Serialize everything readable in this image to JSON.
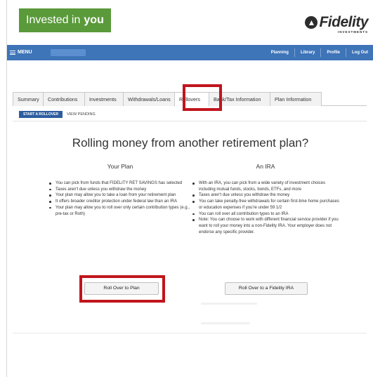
{
  "brand": {
    "invested_text": "Invested in",
    "invested_you": "you",
    "logo_word": "Fidelity",
    "logo_sub": "INVESTMENTS",
    "brand_green": "#5a9a3a"
  },
  "navbar": {
    "menu_label": "MENU",
    "links": [
      "Planning",
      "Library",
      "Profile",
      "Log Out"
    ],
    "color": "#3e74b8"
  },
  "tabs": {
    "items": [
      {
        "label": "Summary"
      },
      {
        "label": "Contributions"
      },
      {
        "label": "Investments"
      },
      {
        "label": "Withdrawals/Loans"
      },
      {
        "label": "Rollovers"
      },
      {
        "label": "Bank/Tax Information"
      },
      {
        "label": "Plan Information"
      }
    ],
    "active": "Rollovers"
  },
  "subtabs": {
    "start_label": "START A ROLLOVER",
    "pending_label": "VIEW PENDING"
  },
  "headline": "Rolling money from another retirement plan?",
  "your_plan": {
    "title": "Your Plan",
    "bullets": [
      "You can pick from funds that FIDELITY RET SAVINGS has selected",
      "Taxes aren't due unless you withdraw the money",
      "Your plan may allow you to take a loan from your retirement plan",
      "It offers broader creditor protection under federal law than an IRA",
      "Your plan may allow you to roll over only certain contribution types (e.g., pre-tax or Roth)"
    ],
    "button_label": "Roll Over to Plan"
  },
  "an_ira": {
    "title": "An IRA",
    "bullets": [
      "With an IRA, you can pick from a wide variety of investment choices including mutual funds, stocks, bonds, ETFs, and more",
      "Taxes aren't due unless you withdraw the money",
      "You can take penalty-free withdrawals for certain first-time home purchases or education expenses if you're under 59 1/2",
      "You can roll over all contribution types to an IRA",
      "Note: You can choose to work with different financial service provider if you want to roll your money into a non-Fidelity IRA. Your employer does not endorse any specific provider."
    ],
    "button_label": "Roll Over to a Fidelity IRA"
  },
  "highlight_color": "#c0151c"
}
